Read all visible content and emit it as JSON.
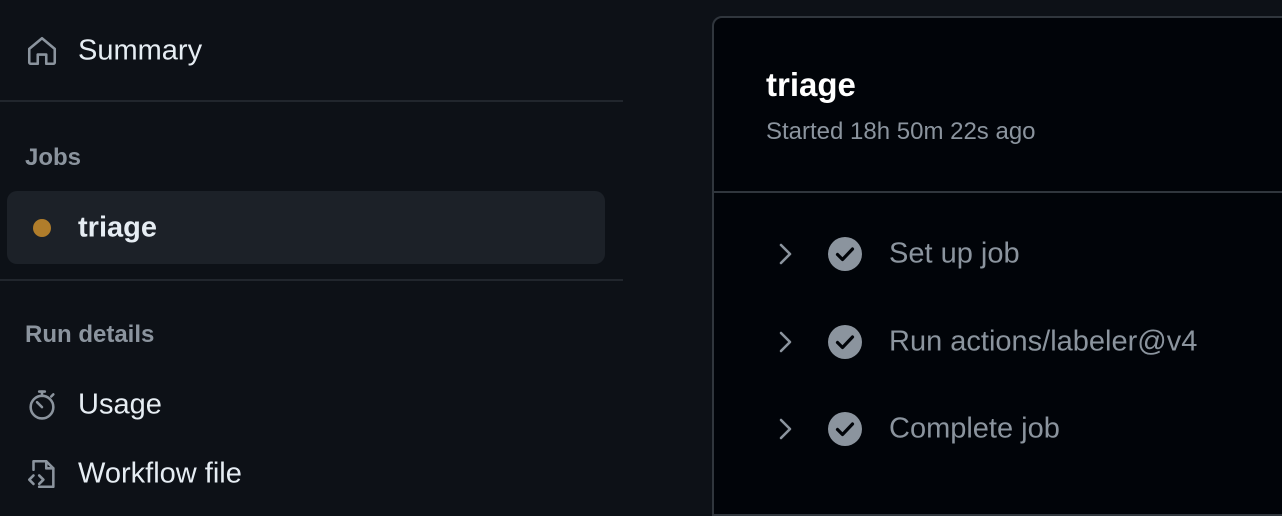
{
  "sidebar": {
    "summary": {
      "label": "Summary",
      "icon": "home-icon"
    },
    "jobs_heading": "Jobs",
    "jobs": [
      {
        "label": "triage",
        "status": "in-progress",
        "status_color": "#b07d2b"
      }
    ],
    "run_details_heading": "Run details",
    "run_details": [
      {
        "label": "Usage",
        "icon": "stopwatch-icon"
      },
      {
        "label": "Workflow file",
        "icon": "file-code-icon"
      }
    ]
  },
  "job_panel": {
    "title": "triage",
    "subtitle": "Started 18h 50m 22s ago",
    "steps": [
      {
        "label": "Set up job",
        "status": "success"
      },
      {
        "label": "Run actions/labeler@v4",
        "status": "success"
      },
      {
        "label": "Complete job",
        "status": "success"
      }
    ]
  },
  "colors": {
    "background": "#0d1117",
    "panel_background": "#010409",
    "border": "#30363d",
    "muted_text": "#8b949e",
    "primary_text": "#e6edf3",
    "in_progress": "#b07d2b"
  }
}
